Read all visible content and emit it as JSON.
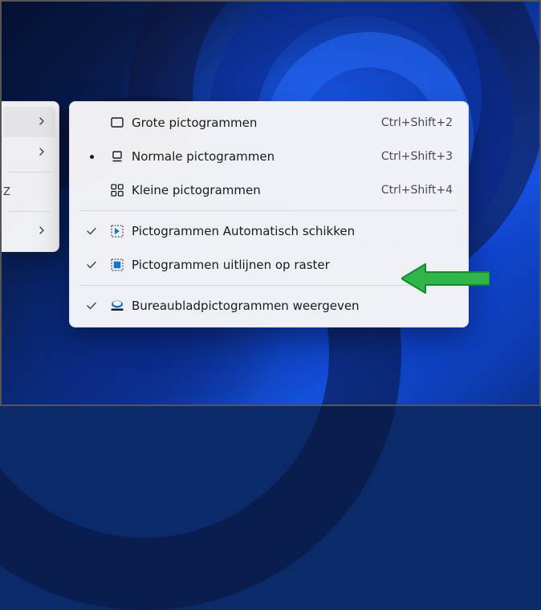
{
  "parent_menu": {
    "items": [
      {
        "has_submenu": true
      },
      {
        "has_submenu": true
      },
      {
        "sep": true
      },
      {
        "shortcut": "Ctrl+Z"
      },
      {
        "sep": true
      },
      {
        "has_submenu": true
      }
    ]
  },
  "submenu": {
    "items": [
      {
        "icon": "large-icons",
        "label": "Grote pictogrammen",
        "shortcut": "Ctrl+Shift+2",
        "marker": ""
      },
      {
        "icon": "medium-icons",
        "label": "Normale pictogrammen",
        "shortcut": "Ctrl+Shift+3",
        "marker": "radio"
      },
      {
        "icon": "small-icons",
        "label": "Kleine pictogrammen",
        "shortcut": "Ctrl+Shift+4",
        "marker": ""
      },
      {
        "sep": true
      },
      {
        "icon": "auto-arrange",
        "label": "Pictogrammen Automatisch schikken",
        "shortcut": "",
        "marker": "check"
      },
      {
        "icon": "align-grid",
        "label": "Pictogrammen uitlijnen op raster",
        "shortcut": "",
        "marker": "check"
      },
      {
        "sep": true
      },
      {
        "icon": "show-desktop",
        "label": "Bureaubladpictogrammen weergeven",
        "shortcut": "",
        "marker": "check"
      }
    ]
  }
}
